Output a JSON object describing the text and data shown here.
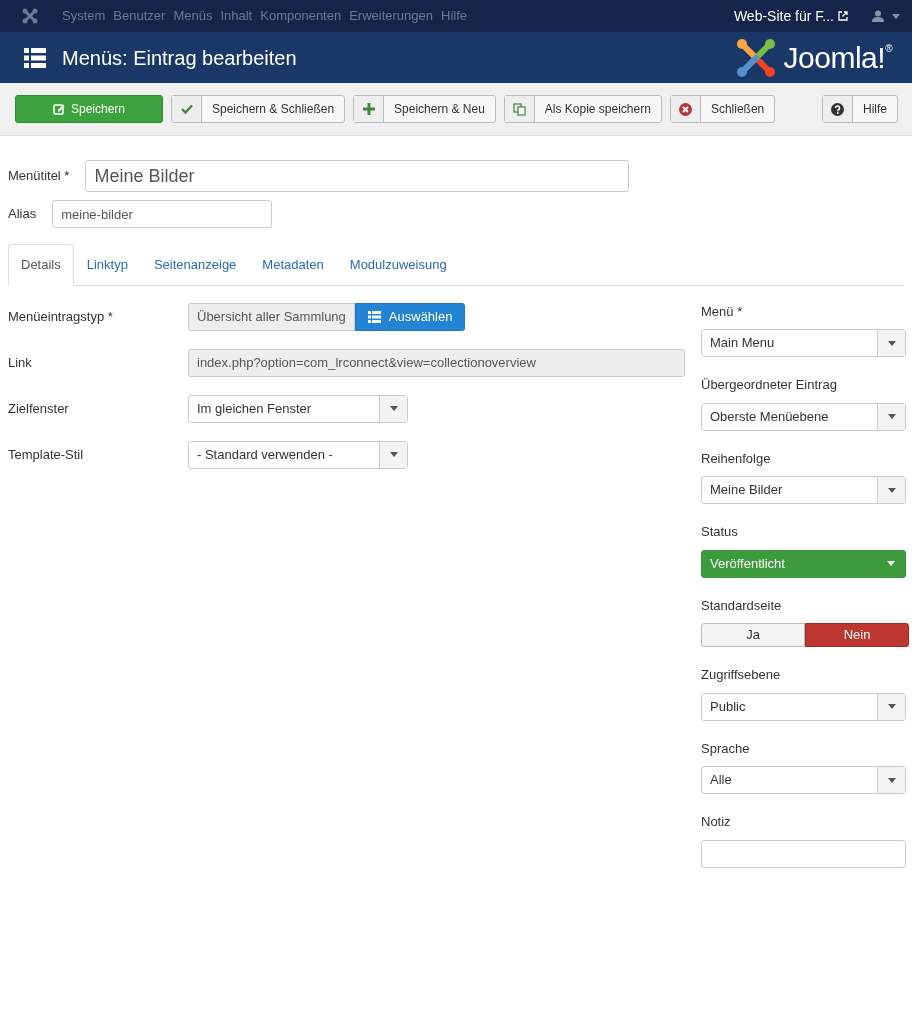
{
  "topbar": {
    "menu": [
      "System",
      "Benutzer",
      "Menüs",
      "Inhalt",
      "Komponenten",
      "Erweiterungen",
      "Hilfe"
    ],
    "site_link": "Web-Site für F..."
  },
  "header": {
    "title": "Menüs: Eintrag bearbeiten",
    "logo": "Joomla!$^{®}$"
  },
  "toolbar": [
    {
      "label": "Speichern",
      "kind": "primary"
    },
    {
      "label": "Speichern & Schließen",
      "kind": "default"
    },
    {
      "label": "Speichern & Neu",
      "kind": "default"
    },
    {
      "label": "Als Kopie speichern",
      "kind": "default"
    },
    {
      "label": "Schließen",
      "kind": "default"
    },
    {
      "label": "Hilfe",
      "kind": "default"
    }
  ],
  "title_field": {
    "label": "Menütitel *",
    "value": "Meine Bilder"
  },
  "alias_field": {
    "label": "Alias",
    "value": "meine-bilder"
  },
  "tabs": [
    {
      "label": "Details",
      "selected": true
    },
    {
      "label": "Linktyp",
      "selected": false
    },
    {
      "label": "Seitenanzeige",
      "selected": false
    },
    {
      "label": "Metadaten",
      "selected": false
    },
    {
      "label": "Modulzuweisung",
      "selected": false
    }
  ],
  "details": [
    {
      "label": "Menüeintragstyp *",
      "kind": "picker",
      "value": "Übersicht aller Sammlung",
      "button": "Auswählen"
    },
    {
      "label": "Link",
      "kind": "readonly",
      "value": "index.php?option=com_lrconnect&view=collectionoverview"
    },
    {
      "label": "Zielfenster",
      "kind": "select",
      "value": "Im gleichen Fenster"
    },
    {
      "label": "Template-Stil",
      "kind": "select",
      "value": "- Standard verwenden -"
    }
  ],
  "sidebar": [
    {
      "label": "Menü *",
      "kind": "select",
      "value": "Main Menu"
    },
    {
      "label": "Übergeordneter Eintrag",
      "kind": "select",
      "value": "Oberste Menüebene"
    },
    {
      "label": "Reihenfolge",
      "kind": "select",
      "value": "Meine Bilder"
    },
    {
      "label": "Status",
      "kind": "status",
      "value": "Veröffentlicht",
      "color": "#3c9a3c"
    },
    {
      "label": "Standardseite",
      "kind": "toggle",
      "options": [
        {
          "label": "Ja",
          "selected": false
        },
        {
          "label": "Nein",
          "selected": true
        }
      ]
    },
    {
      "label": "Zugriffsebene",
      "kind": "select",
      "value": "Public"
    },
    {
      "label": "Sprache",
      "kind": "select",
      "value": "Alle"
    },
    {
      "label": "Notiz",
      "kind": "text"
    }
  ]
}
